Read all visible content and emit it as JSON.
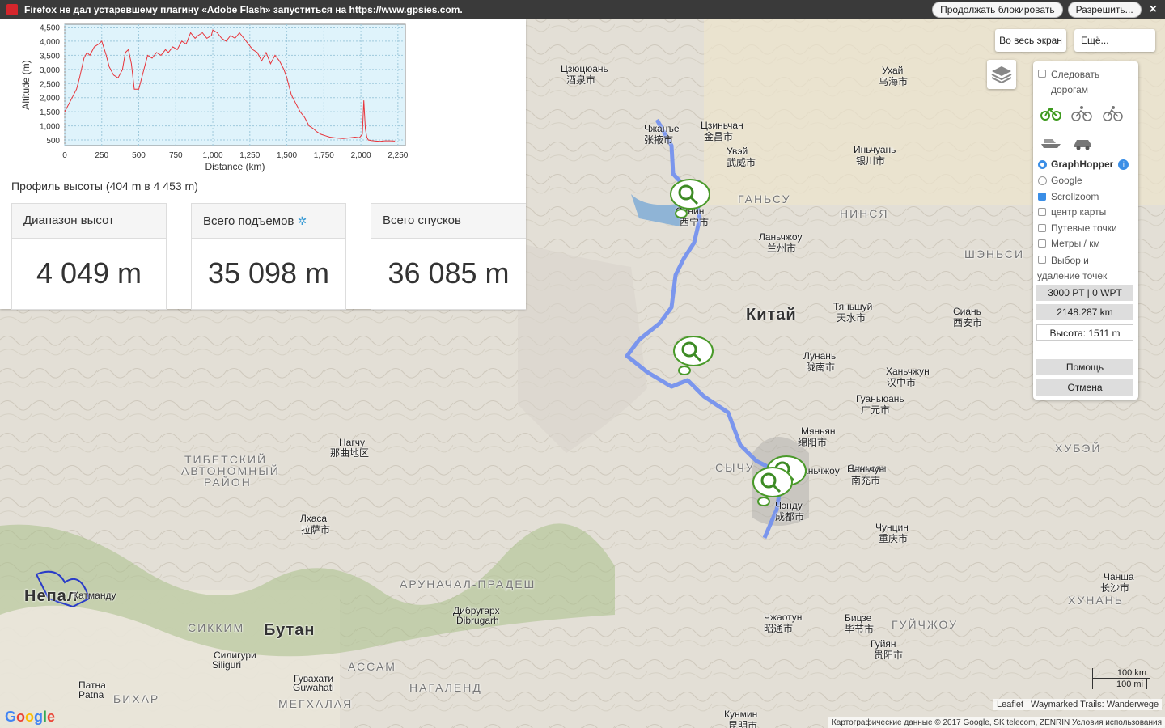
{
  "flash_bar": {
    "message": "Firefox не дал устаревшему плагину «Adobe Flash» запуститься на https://www.gpsies.com.",
    "continue_block": "Продолжать блокировать",
    "allow": "Разрешить...",
    "close": "×"
  },
  "profile": {
    "title": "Профиль высоты (404 m в 4 453 m)",
    "stats": [
      {
        "label": "Диапазон высот",
        "value": "4 049 m"
      },
      {
        "label": "Всего подъемов",
        "value": "35 098 m"
      },
      {
        "label": "Всего спусков",
        "value": "36 085 m"
      }
    ]
  },
  "chart_data": {
    "type": "line",
    "xlabel": "Distance (km)",
    "ylabel": "Altitude (m)",
    "xlim": [
      0,
      2300
    ],
    "ylim": [
      300,
      4600
    ],
    "xticks": [
      "0",
      "250",
      "500",
      "750",
      "1,000",
      "1,250",
      "1,500",
      "1,750",
      "2,000",
      "2,250"
    ],
    "yticks": [
      "500",
      "1,000",
      "1,500",
      "2,000",
      "2,500",
      "3,000",
      "3,500",
      "4,000",
      "4,500"
    ],
    "grid": true,
    "color": "#e8333a",
    "x": [
      0,
      20,
      50,
      80,
      100,
      130,
      150,
      170,
      200,
      230,
      250,
      280,
      300,
      330,
      360,
      390,
      410,
      430,
      450,
      470,
      500,
      530,
      560,
      590,
      620,
      650,
      680,
      700,
      730,
      760,
      790,
      820,
      850,
      880,
      900,
      930,
      960,
      990,
      1000,
      1030,
      1060,
      1090,
      1120,
      1150,
      1180,
      1210,
      1240,
      1270,
      1300,
      1330,
      1360,
      1390,
      1420,
      1450,
      1480,
      1500,
      1530,
      1560,
      1590,
      1620,
      1650,
      1680,
      1700,
      1730,
      1760,
      1790,
      1820,
      1850,
      1880,
      1900,
      1930,
      1960,
      1990,
      2010,
      2020,
      2030,
      2040,
      2050,
      2070,
      2100,
      2130,
      2160,
      2200,
      2230
    ],
    "y": [
      1500,
      1700,
      2000,
      2300,
      2700,
      3400,
      3600,
      3500,
      3800,
      3900,
      4000,
      3500,
      3100,
      2800,
      2700,
      3000,
      3600,
      3700,
      3200,
      2300,
      2300,
      2900,
      3500,
      3400,
      3600,
      3500,
      3700,
      3600,
      3800,
      3700,
      4000,
      3900,
      4300,
      4100,
      4200,
      4300,
      4100,
      4200,
      4400,
      4300,
      4100,
      4000,
      4200,
      4100,
      4300,
      4100,
      3900,
      3700,
      3600,
      3300,
      3600,
      3200,
      3500,
      3300,
      3000,
      2700,
      2100,
      1800,
      1500,
      1300,
      1000,
      900,
      800,
      700,
      650,
      600,
      580,
      560,
      550,
      560,
      580,
      600,
      580,
      700,
      1900,
      900,
      600,
      500,
      480,
      460,
      450,
      470,
      470,
      460
    ]
  },
  "map_controls": {
    "fullscreen": "Во весь экран",
    "more": "Ещё...",
    "layers_icon": "layers-icon"
  },
  "side_panel": {
    "follow_roads": "Следовать дорогам",
    "profiles": [
      "bicycle-icon",
      "road-bike-icon",
      "mtb-icon",
      "boat-icon",
      "car-icon"
    ],
    "routers": [
      {
        "label": "GraphHopper",
        "selected": true
      },
      {
        "label": "Google",
        "selected": false
      }
    ],
    "options": [
      {
        "label": "Scrollzoom",
        "checked": true
      },
      {
        "label": "центр карты",
        "checked": false
      },
      {
        "label": "Путевые точки",
        "checked": false
      },
      {
        "label": "Метры / км",
        "checked": false
      },
      {
        "label": "Выбор и удаление точек",
        "checked": false
      }
    ],
    "counts": "3000 PT | 0 WPT",
    "distance": "2148.287 km",
    "altitude": "Высота: 1511 m",
    "help": "Помощь",
    "cancel": "Отмена"
  },
  "map_labels": [
    {
      "text": "Китай",
      "cls": "big"
    },
    {
      "text": "Непал",
      "cls": "big"
    },
    {
      "text": "Бутан",
      "cls": "big"
    },
    {
      "text": "ГАНЬСУ",
      "cls": "reg"
    },
    {
      "text": "НИНСЯ",
      "cls": "reg"
    },
    {
      "text": "ШЭНЬСИ",
      "cls": "reg"
    },
    {
      "text": "ХУБЭЙ",
      "cls": "reg"
    },
    {
      "text": "ХУНАНЬ",
      "cls": "reg"
    },
    {
      "text": "ГУЙЧЖОУ",
      "cls": "reg"
    },
    {
      "text": "СЫЧУ",
      "cls": "reg"
    },
    {
      "text": "ТИБЕТСКИЙ",
      "cls": "reg"
    },
    {
      "text": "АВТОНОМНЫЙ",
      "cls": "reg"
    },
    {
      "text": "РАЙОН",
      "cls": "reg"
    },
    {
      "text": "АРУНАЧАЛ-ПРАДЕШ",
      "cls": "reg"
    },
    {
      "text": "СИККИМ",
      "cls": "reg"
    },
    {
      "text": "АССАМ",
      "cls": "reg"
    },
    {
      "text": "НАГАЛЕНД",
      "cls": "reg"
    },
    {
      "text": "МЕГХАЛАЯ",
      "cls": "reg"
    },
    {
      "text": "БИХАР",
      "cls": "reg"
    },
    {
      "text": "Ланьчжоу",
      "cls": ""
    },
    {
      "text": "兰州市",
      "cls": ""
    },
    {
      "text": "Синин",
      "cls": ""
    },
    {
      "text": "西宁市",
      "cls": ""
    },
    {
      "text": "Чэнду",
      "cls": ""
    },
    {
      "text": "成都市",
      "cls": ""
    },
    {
      "text": "Чунцин",
      "cls": ""
    },
    {
      "text": "重庆市",
      "cls": ""
    },
    {
      "text": "Сиань",
      "cls": ""
    },
    {
      "text": "西安市",
      "cls": ""
    },
    {
      "text": "Ухай",
      "cls": ""
    },
    {
      "text": "乌海市",
      "cls": ""
    },
    {
      "text": "Иньчуань",
      "cls": ""
    },
    {
      "text": "银川市",
      "cls": ""
    },
    {
      "text": "Лхаса",
      "cls": ""
    },
    {
      "text": "拉萨市",
      "cls": ""
    },
    {
      "text": "Нагчу",
      "cls": ""
    },
    {
      "text": "那曲地区",
      "cls": ""
    },
    {
      "text": "Катманду",
      "cls": ""
    },
    {
      "text": "Гувахати",
      "cls": ""
    },
    {
      "text": "Guwahati",
      "cls": ""
    },
    {
      "text": "Силигури",
      "cls": ""
    },
    {
      "text": "Siliguri",
      "cls": ""
    },
    {
      "text": "Патна",
      "cls": ""
    },
    {
      "text": "Patna",
      "cls": ""
    },
    {
      "text": "Кунмин",
      "cls": ""
    },
    {
      "text": "昆明市",
      "cls": ""
    },
    {
      "text": "Чанша",
      "cls": ""
    },
    {
      "text": "长沙市",
      "cls": ""
    },
    {
      "text": "Гуйян",
      "cls": ""
    },
    {
      "text": "贵阳市",
      "cls": ""
    },
    {
      "text": "Мяньян",
      "cls": ""
    },
    {
      "text": "绵阳市",
      "cls": ""
    },
    {
      "text": "Синьсян",
      "cls": ""
    },
    {
      "text": "Дибругарх",
      "cls": ""
    },
    {
      "text": "Dibrugarh",
      "cls": ""
    },
    {
      "text": "Цзюцюань",
      "cls": ""
    },
    {
      "text": "酒泉市",
      "cls": ""
    },
    {
      "text": "Чжанъе",
      "cls": ""
    },
    {
      "text": "张掖市",
      "cls": ""
    },
    {
      "text": "Цзиньчан",
      "cls": ""
    },
    {
      "text": "金昌市",
      "cls": ""
    },
    {
      "text": "Увэй",
      "cls": ""
    },
    {
      "text": "武威市",
      "cls": ""
    },
    {
      "text": "Наньчун",
      "cls": ""
    },
    {
      "text": "南充市",
      "cls": ""
    },
    {
      "text": "Даньчжоу",
      "cls": ""
    },
    {
      "text": "Ханьчжун",
      "cls": ""
    },
    {
      "text": "汉中市",
      "cls": ""
    },
    {
      "text": "Гуаньюань",
      "cls": ""
    },
    {
      "text": "广元市",
      "cls": ""
    },
    {
      "text": "Бицзе",
      "cls": ""
    },
    {
      "text": "毕节市",
      "cls": ""
    },
    {
      "text": "Чжаотун",
      "cls": ""
    },
    {
      "text": "昭通市",
      "cls": ""
    },
    {
      "text": "Лунань",
      "cls": ""
    },
    {
      "text": "陇南市",
      "cls": ""
    },
    {
      "text": "Тяньшуй",
      "cls": ""
    },
    {
      "text": "天水市",
      "cls": ""
    }
  ],
  "attribution": "Картографические данные © 2017 Google, SK telecom, ZENRIN   Условия использования",
  "attribution2": "Leaflet | Waymarked Trails: Wanderwege",
  "scale": {
    "km": "100 km",
    "mi": "100 mi"
  },
  "google_logo": "Google"
}
